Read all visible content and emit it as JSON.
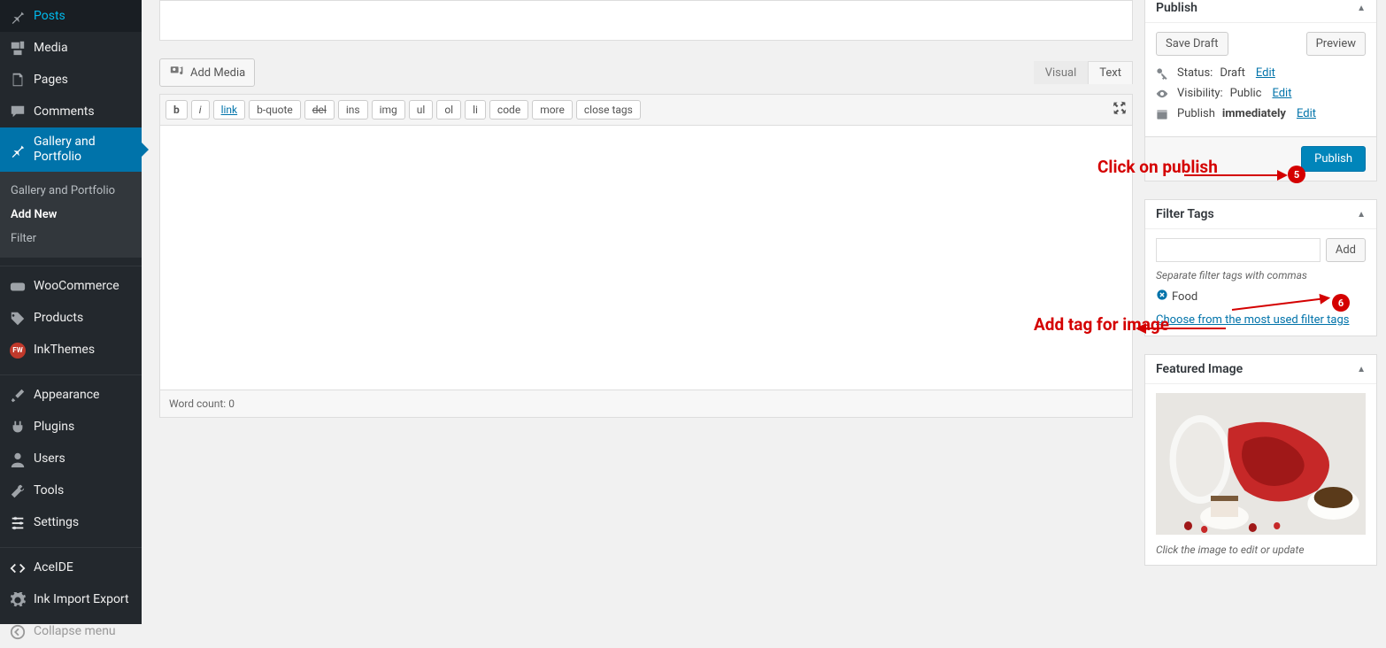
{
  "sidebar": {
    "items": [
      {
        "id": "posts",
        "label": "Posts"
      },
      {
        "id": "media",
        "label": "Media"
      },
      {
        "id": "pages",
        "label": "Pages"
      },
      {
        "id": "comments",
        "label": "Comments"
      },
      {
        "id": "gallery",
        "label": "Gallery and Portfolio"
      },
      {
        "id": "woocommerce",
        "label": "WooCommerce"
      },
      {
        "id": "products",
        "label": "Products"
      },
      {
        "id": "inkthemes",
        "label": "InkThemes"
      },
      {
        "id": "appearance",
        "label": "Appearance"
      },
      {
        "id": "plugins",
        "label": "Plugins"
      },
      {
        "id": "users",
        "label": "Users"
      },
      {
        "id": "tools",
        "label": "Tools"
      },
      {
        "id": "settings",
        "label": "Settings"
      },
      {
        "id": "aceide",
        "label": "AceIDE"
      },
      {
        "id": "inkimport",
        "label": "Ink Import Export"
      }
    ],
    "sub": {
      "items": [
        "Gallery and Portfolio",
        "Add New",
        "Filter"
      ],
      "current_index": 1
    },
    "collapse": "Collapse menu"
  },
  "editor": {
    "add_media": "Add Media",
    "tabs": {
      "visual": "Visual",
      "text": "Text"
    },
    "quicktags": [
      "b",
      "i",
      "link",
      "b-quote",
      "del",
      "ins",
      "img",
      "ul",
      "ol",
      "li",
      "code",
      "more",
      "close tags"
    ],
    "word_count_label": "Word count:",
    "word_count_value": "0"
  },
  "publish_box": {
    "title": "Publish",
    "save_draft": "Save Draft",
    "preview": "Preview",
    "status_label": "Status:",
    "status_value": "Draft",
    "visibility_label": "Visibility:",
    "visibility_value": "Public",
    "schedule_label": "Publish",
    "schedule_value": "immediately",
    "edit": "Edit",
    "publish_btn": "Publish"
  },
  "filter_tags": {
    "title": "Filter Tags",
    "add_btn": "Add",
    "help": "Separate filter tags with commas",
    "tags": [
      "Food"
    ],
    "choose": "Choose from the most used filter tags"
  },
  "featured": {
    "title": "Featured Image",
    "caption": "Click the image to edit or update"
  },
  "annotations": {
    "a5": {
      "text": "Click on publish",
      "badge": "5"
    },
    "a6": {
      "text": "Add tag for image",
      "badge": "6"
    }
  }
}
